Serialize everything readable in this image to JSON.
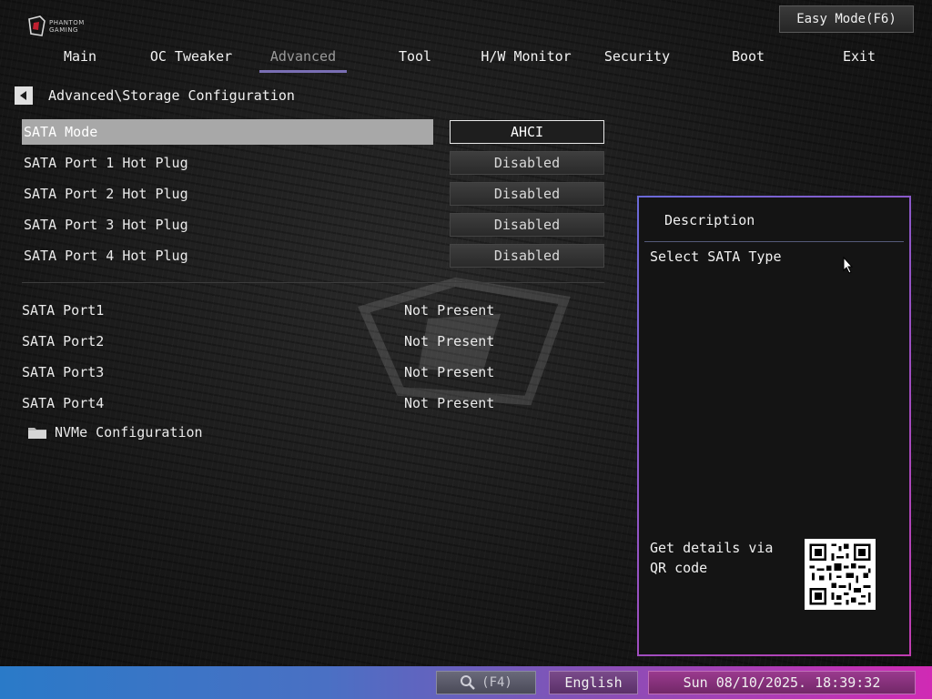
{
  "header": {
    "logo_line1": "PHANTOM",
    "logo_line2": "GAMING",
    "easy_mode_label": "Easy Mode(F6)"
  },
  "nav": {
    "tabs": [
      {
        "label": "Main",
        "active": false
      },
      {
        "label": "OC Tweaker",
        "active": false
      },
      {
        "label": "Advanced",
        "active": true
      },
      {
        "label": "Tool",
        "active": false
      },
      {
        "label": "H/W Monitor",
        "active": false
      },
      {
        "label": "Security",
        "active": false
      },
      {
        "label": "Boot",
        "active": false
      },
      {
        "label": "Exit",
        "active": false
      }
    ]
  },
  "breadcrumb": "Advanced\\Storage Configuration",
  "settings": [
    {
      "label": "SATA Mode",
      "value": "AHCI",
      "selected": true
    },
    {
      "label": "SATA Port 1 Hot Plug",
      "value": "Disabled",
      "selected": false
    },
    {
      "label": "SATA Port 2 Hot Plug",
      "value": "Disabled",
      "selected": false
    },
    {
      "label": "SATA Port 3 Hot Plug",
      "value": "Disabled",
      "selected": false
    },
    {
      "label": "SATA Port 4 Hot Plug",
      "value": "Disabled",
      "selected": false
    }
  ],
  "ports": [
    {
      "label": "SATA Port1",
      "value": "Not Present"
    },
    {
      "label": "SATA Port2",
      "value": "Not Present"
    },
    {
      "label": "SATA Port3",
      "value": "Not Present"
    },
    {
      "label": "SATA Port4",
      "value": "Not Present"
    }
  ],
  "submenu": {
    "label": "NVMe Configuration",
    "icon": "folder-icon"
  },
  "description": {
    "title": "Description",
    "text": "Select SATA Type",
    "qr_text": "Get details via QR code"
  },
  "footer": {
    "search_label": "(F4)",
    "language": "English",
    "datetime": "Sun 08/10/2025. 18:39:32"
  },
  "colors": {
    "selected_row_bg": "#a8a8a8",
    "active_tab_underline": "#7a6fb4",
    "panel_border_start": "#6a6ad8",
    "panel_border_end": "#c03cb0"
  }
}
